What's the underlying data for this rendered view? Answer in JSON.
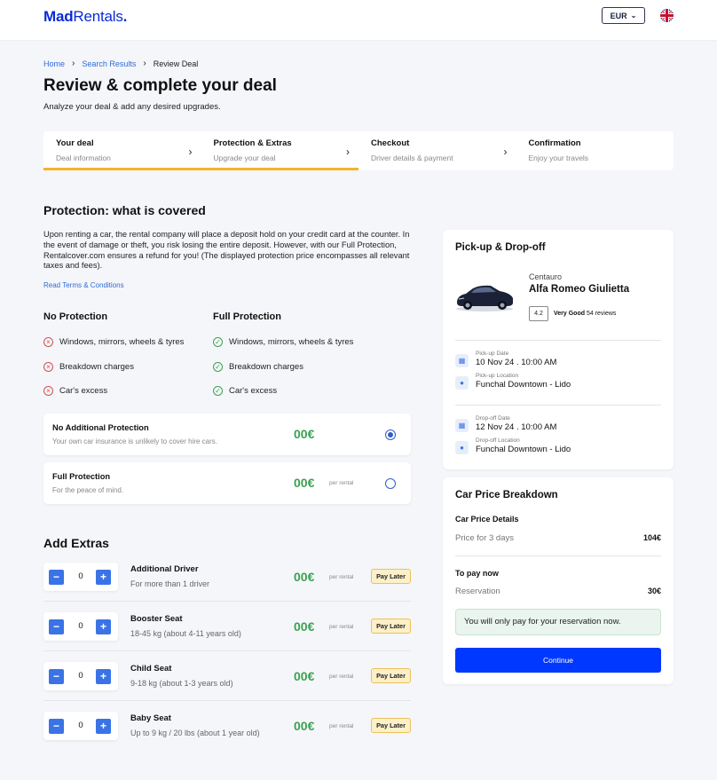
{
  "header": {
    "logo_bold": "Mad",
    "logo_light": "Rentals",
    "logo_dot": ".",
    "currency": "EUR"
  },
  "breadcrumb": [
    "Home",
    "Search Results",
    "Review Deal"
  ],
  "page": {
    "title": "Review & complete your deal",
    "subtitle": "Analyze your deal & add any desired upgrades."
  },
  "steps": [
    {
      "title": "Your deal",
      "sub": "Deal information"
    },
    {
      "title": "Protection & Extras",
      "sub": "Upgrade your deal"
    },
    {
      "title": "Checkout",
      "sub": "Driver details & payment"
    },
    {
      "title": "Confirmation",
      "sub": "Enjoy your travels"
    }
  ],
  "protection": {
    "title": "Protection: what is covered",
    "paragraph": "Upon renting a car, the rental company will place a deposit hold on your credit card at the counter. In the event of damage or theft, you risk losing the entire deposit. However, with our Full Protection, Rentalcover.com ensures a refund for you! (The displayed protection price encompasses all relevant taxes and fees).",
    "terms_link": "Read Terms & Conditions",
    "no_title": "No Protection",
    "full_title": "Full Protection",
    "features": [
      "Windows, mirrors, wheels & tyres",
      "Breakdown charges",
      "Car's excess"
    ],
    "options": [
      {
        "title": "No Additional Protection",
        "sub": "Your own car insurance is unlikely to cover hire cars.",
        "price": "00€",
        "per": "",
        "selected": true
      },
      {
        "title": "Full Protection",
        "sub": "For the peace of mind.",
        "price": "00€",
        "per": "per rental",
        "selected": false
      }
    ]
  },
  "extras": {
    "title": "Add Extras",
    "items": [
      {
        "name": "Additional Driver",
        "desc": "For more than 1 driver",
        "qty": "0",
        "price": "00€",
        "per": "per rental",
        "badge": "Pay Later"
      },
      {
        "name": "Booster Seat",
        "desc": "18-45 kg (about 4-11 years old)",
        "qty": "0",
        "price": "00€",
        "per": "per rental",
        "badge": "Pay Later"
      },
      {
        "name": "Child Seat",
        "desc": " 9-18 kg (about 1-3 years old)",
        "qty": "0",
        "price": "00€",
        "per": "per rental",
        "badge": "Pay Later"
      },
      {
        "name": "Baby Seat",
        "desc": "Up to 9 kg / 20 lbs (about 1 year old)",
        "qty": "0",
        "price": "00€",
        "per": "per rental",
        "badge": "Pay Later"
      }
    ],
    "minus": "−",
    "plus": "+"
  },
  "pickup": {
    "title": "Pick-up & Drop-off",
    "supplier": "Centauro",
    "car": "Alfa Romeo Giulietta",
    "rating": "4.2",
    "rating_word": "Very Good",
    "reviews": "54 reviews",
    "pickup_date_label": "Pick-up Date",
    "pickup_date": "10 Nov 24 . 10:00 AM",
    "pickup_loc_label": "Pick-up Location",
    "pickup_loc": "Funchal Downtown - Lido",
    "dropoff_date_label": "Drop-off Date",
    "dropoff_date": "12 Nov 24 . 10:00 AM",
    "dropoff_loc_label": "Drop-off Location",
    "dropoff_loc": "Funchal Downtown - Lido"
  },
  "breakdown": {
    "title": "Car Price Breakdown",
    "details_title": "Car Price Details",
    "price_label": "Price for 3 days",
    "price_value": "104€",
    "pay_now_title": "To pay now",
    "reservation_label": "Reservation",
    "reservation_value": "30€",
    "notice": "You will only pay for your reservation now.",
    "continue": "Continue"
  },
  "colors": {
    "brand": "#0a2bd6",
    "accent_bar": "#f1b52b",
    "price_green": "#3aa251",
    "button_blue": "#0038ff"
  }
}
